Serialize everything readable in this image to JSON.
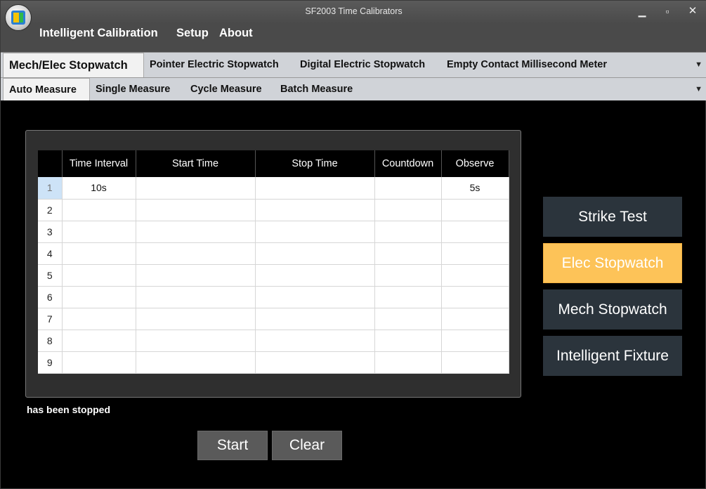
{
  "window": {
    "title": "SF2003 Time Calibrators",
    "minimize": "▁",
    "maximize": "▫",
    "close": "✕"
  },
  "menu": {
    "items": [
      "Intelligent Calibration",
      "Setup",
      "About"
    ]
  },
  "tabs_primary": {
    "items": [
      "Mech/Elec Stopwatch",
      "Pointer Electric Stopwatch",
      "Digital Electric Stopwatch",
      "Empty Contact Millisecond Meter"
    ],
    "active": "Mech/Elec Stopwatch",
    "overflow_icon": "▼"
  },
  "tabs_secondary": {
    "items": [
      "Auto Measure",
      "Single Measure",
      "Cycle Measure",
      "Batch Measure"
    ],
    "active": "Auto Measure",
    "overflow_icon": "▼"
  },
  "grid": {
    "columns": [
      "",
      "Time Interval",
      "Start Time",
      "Stop Time",
      "Countdown",
      "Observe"
    ],
    "rows": [
      [
        "1",
        "10s",
        "",
        "",
        "",
        "5s"
      ],
      [
        "2",
        "",
        "",
        "",
        "",
        ""
      ],
      [
        "3",
        "",
        "",
        "",
        "",
        ""
      ],
      [
        "4",
        "",
        "",
        "",
        "",
        ""
      ],
      [
        "5",
        "",
        "",
        "",
        "",
        ""
      ],
      [
        "6",
        "",
        "",
        "",
        "",
        ""
      ],
      [
        "7",
        "",
        "",
        "",
        "",
        ""
      ],
      [
        "8",
        "",
        "",
        "",
        "",
        ""
      ],
      [
        "9",
        "",
        "",
        "",
        "",
        ""
      ]
    ]
  },
  "status": "has been stopped",
  "actions": {
    "start": "Start",
    "clear": "Clear"
  },
  "modes": {
    "items": [
      "Strike Test",
      "Elec Stopwatch",
      "Mech Stopwatch",
      "Intelligent Fixture"
    ],
    "active": "Elec Stopwatch",
    "active_color": "#fdc358",
    "inactive_color": "#2b343c"
  }
}
